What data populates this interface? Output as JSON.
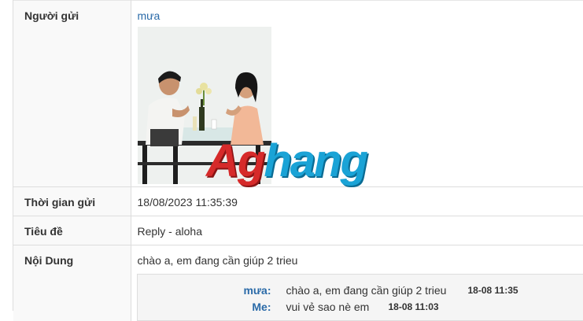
{
  "rows": {
    "sender": {
      "label": "Người gửi",
      "value": "mưa"
    },
    "time": {
      "label": "Thời gian gửi",
      "value": "18/08/2023 11:35:39"
    },
    "subject": {
      "label": "Tiêu đề",
      "value": "Reply - aloha"
    },
    "content": {
      "label": "Nội Dung",
      "value": "chào a, em đang cần giúp 2 trieu"
    }
  },
  "watermark": {
    "part1": "Ag",
    "part2": "hang"
  },
  "chat": [
    {
      "who": "mưa",
      "colon": ":",
      "text": "chào a, em đang cần giúp 2 trieu",
      "date": "18-08",
      "time": "11:35"
    },
    {
      "who": "Me",
      "colon": ":",
      "text": "vui vẻ sao nè em",
      "date": "18-08",
      "time": "11:03"
    }
  ],
  "colors": {
    "link": "#2a6aa8",
    "label_bg": "#f9f9f9",
    "border": "#dddddd"
  }
}
